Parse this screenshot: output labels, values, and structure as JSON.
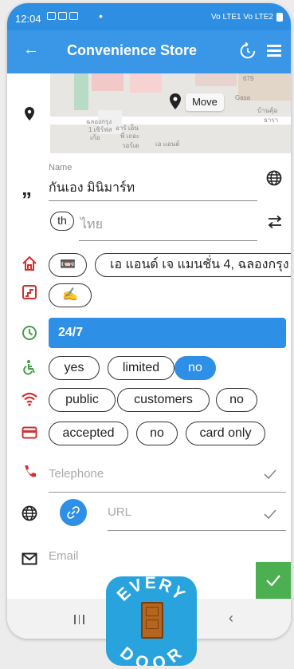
{
  "status_bar": {
    "time": "12:04",
    "dot": "•",
    "network_text": "Vo LTE1 Vo LTE2"
  },
  "app_bar": {
    "title": "Convenience Store",
    "back_icon": "arrow-left-icon",
    "history_icon": "history-icon",
    "list_icon": "list-icon"
  },
  "map": {
    "move_label": "Move",
    "labels": [
      "679",
      "ฉลองกรุง",
      "1 เซิร์ฟส",
      "เก้อ",
      "อาร์ เอ็น",
      "พี เถอะ",
      "วอร์เด",
      "เอ แอนด์",
      "บ้านคุ้ม",
      "ธารา",
      "Gasa"
    ]
  },
  "name": {
    "label": "Name",
    "value": "กันเอง มินิมาร์ท",
    "lang_code": "th",
    "lang_placeholder": "ไทย"
  },
  "address": {
    "chip_icon": "📼",
    "text": "เอ แอนด์ เจ แมนชั่น 4, ฉลองกรุง"
  },
  "levels": {
    "chip_icon": "✍"
  },
  "opening_hours": {
    "value": "24/7"
  },
  "wheelchair": {
    "options": [
      "yes",
      "limited",
      "no"
    ],
    "selected": "no"
  },
  "wifi": {
    "options": [
      "public",
      "customers",
      "no"
    ]
  },
  "payment": {
    "options": [
      "accepted",
      "no",
      "card only"
    ]
  },
  "fields": {
    "telephone_placeholder": "Telephone",
    "url_placeholder": "URL",
    "email_placeholder": "Email"
  },
  "logo": {
    "top_text": "EVERY",
    "bottom_text": "DOOR"
  },
  "colors": {
    "primary": "#2d8fe6",
    "accent_red": "#d32f2f",
    "green": "#4caf50"
  }
}
